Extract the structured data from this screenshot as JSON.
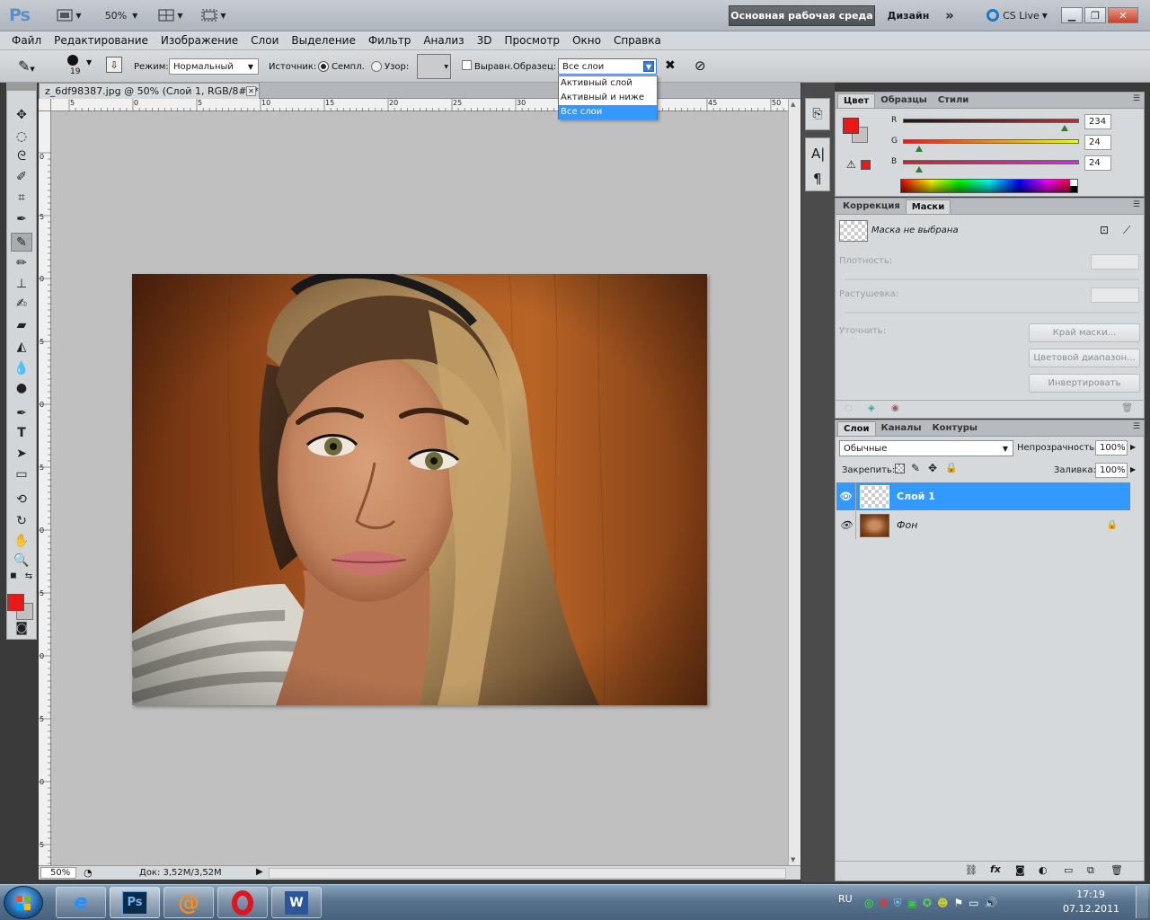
{
  "appbar": {
    "logo": "Ps",
    "zoom": "50%",
    "workspace_active": "Основная рабочая среда",
    "workspace_other": "Дизайн",
    "more": "»",
    "cs_live": "CS Live"
  },
  "menu": [
    "Файл",
    "Редактирование",
    "Изображение",
    "Слои",
    "Выделение",
    "Фильтр",
    "Анализ",
    "3D",
    "Просмотр",
    "Окно",
    "Справка"
  ],
  "options": {
    "brush_size": "19",
    "mode_label": "Режим:",
    "mode_value": "Нормальный",
    "source_label": "Источник:",
    "source_sampled": "Семпл.",
    "source_pattern": "Узор:",
    "aligned_label": "Выравн.",
    "sample_label": "Образец:",
    "sample_value": "Все слои",
    "sample_options": [
      "Активный слой",
      "Активный и ниже",
      "Все слои"
    ],
    "sample_selected_index": 2
  },
  "document": {
    "tab_title": "z_6df98387.jpg @ 50% (Слой 1, RGB/8#) *",
    "hruler_labels": [
      "5",
      "0",
      "5",
      "10",
      "15",
      "20",
      "25",
      "30",
      "35",
      "40",
      "45",
      "50"
    ],
    "vruler_labels": [
      "0",
      "5",
      "0",
      "5",
      "0",
      "5",
      "0",
      "5",
      "0",
      "5",
      "0",
      "5"
    ],
    "status_zoom": "50%",
    "status_doc": "Док: 3,52M/3,52M"
  },
  "color_panel": {
    "tabs": [
      "Цвет",
      "Образцы",
      "Стили"
    ],
    "r_label": "R",
    "g_label": "G",
    "b_label": "B",
    "r": "234",
    "g": "24",
    "b": "24",
    "r_frac": 0.918,
    "g_frac": 0.094,
    "b_frac": 0.094,
    "fg_color": "#ea1818",
    "bg_color": "#c4c0c0"
  },
  "masks_panel": {
    "tabs": [
      "Коррекция",
      "Маски"
    ],
    "no_mask": "Маска не выбрана",
    "density_label": "Плотность:",
    "feather_label": "Растушевка:",
    "refine_label": "Уточнить:",
    "btn_edge": "Край маски...",
    "btn_color_range": "Цветовой диапазон...",
    "btn_invert": "Инвертировать"
  },
  "layers_panel": {
    "tabs": [
      "Слои",
      "Каналы",
      "Контуры"
    ],
    "blend_mode": "Обычные",
    "opacity_label": "Непрозрачность:",
    "opacity": "100%",
    "lock_label": "Закрепить:",
    "fill_label": "Заливка:",
    "fill": "100%",
    "layers": [
      {
        "name": "Слой 1",
        "selected": true
      },
      {
        "name": "Фон",
        "selected": false,
        "locked": true
      }
    ]
  },
  "taskbar": {
    "lang": "RU",
    "time": "17:19",
    "date": "07.12.2011",
    "apps": [
      "ie-icon",
      "photoshop-icon",
      "mail-agent-icon",
      "opera-icon",
      "word-icon"
    ]
  }
}
